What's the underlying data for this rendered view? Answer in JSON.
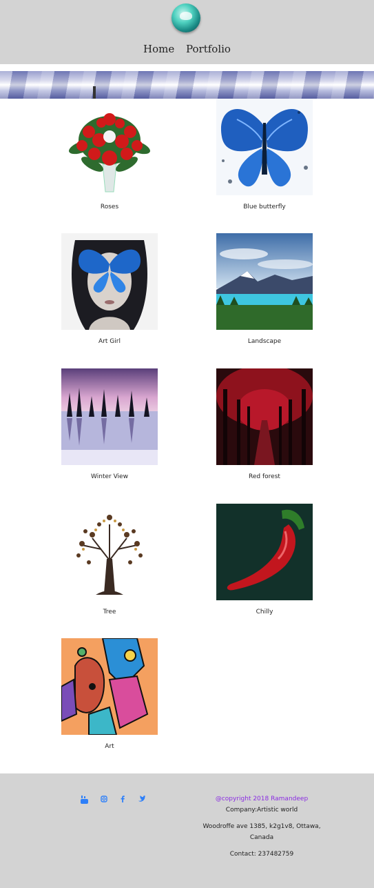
{
  "nav": {
    "home": "Home",
    "portfolio": "Portfolio"
  },
  "gallery": [
    {
      "caption": "Roses"
    },
    {
      "caption": "Blue butterfly"
    },
    {
      "caption": "Art Girl"
    },
    {
      "caption": "Landscape"
    },
    {
      "caption": "Winter View"
    },
    {
      "caption": "Red forest"
    },
    {
      "caption": "Tree"
    },
    {
      "caption": "Chilly"
    },
    {
      "caption": "Art"
    }
  ],
  "footer": {
    "copyright": "@copyright 2018 Ramandeep",
    "company": "Company:Artistic world",
    "address": "Woodroffe ave 1385, k2g1v8, Ottawa, Canada",
    "contact": "Contact: 237482759",
    "social_icons": [
      "youtube-icon",
      "instagram-icon",
      "facebook-icon",
      "twitter-icon"
    ]
  },
  "colors": {
    "header_bg": "#d3d3d3",
    "link_blue": "#2d7ff9",
    "copyright_purple": "#8a2be2"
  }
}
